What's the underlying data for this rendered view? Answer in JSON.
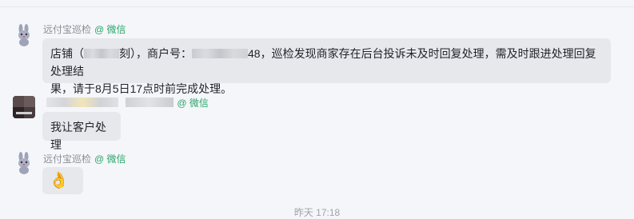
{
  "messages": [
    {
      "sender": "远付宝巡检",
      "sender_tag": "@ 微信",
      "parts": [
        "店铺（",
        "刻），商户号：",
        "48，巡检发现商家存在后台投诉未及时回复处理，需及时跟进处理回复处理结",
        "果，请于8月5日17点时前完成处理。"
      ]
    },
    {
      "sender_tag": "@ 微信",
      "text": "我让客户处理"
    },
    {
      "sender": "远付宝巡检",
      "sender_tag": "@ 微信",
      "emoji": "👌"
    }
  ],
  "timestamp": "昨天 17:18",
  "colors": {
    "background": "#f5f6fa",
    "bubble": "#e6e8ec",
    "wechat_tag": "#2aa568",
    "name_gray": "#8a8d93"
  }
}
